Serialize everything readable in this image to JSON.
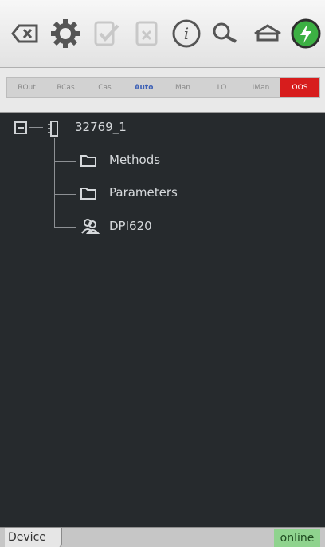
{
  "toolbar": {
    "icons": [
      "backspace-icon",
      "settings-gear-icon",
      "check-document-icon",
      "cancel-document-icon",
      "info-icon",
      "search-icon",
      "home-icon",
      "power-connect-icon"
    ]
  },
  "modes": {
    "items": [
      "ROut",
      "RCas",
      "Cas",
      "Auto",
      "Man",
      "LO",
      "IMan",
      "OOS"
    ],
    "active": "Auto",
    "alarm": "OOS"
  },
  "tree": {
    "root": "32769_1",
    "children": [
      "Methods",
      "Parameters",
      "DPI620"
    ]
  },
  "status": {
    "device_tab": "Device",
    "state": "online"
  },
  "colors": {
    "active_mode": "#3f62b6",
    "oos_red": "#d71d1d",
    "online_green": "#8fd38e"
  }
}
